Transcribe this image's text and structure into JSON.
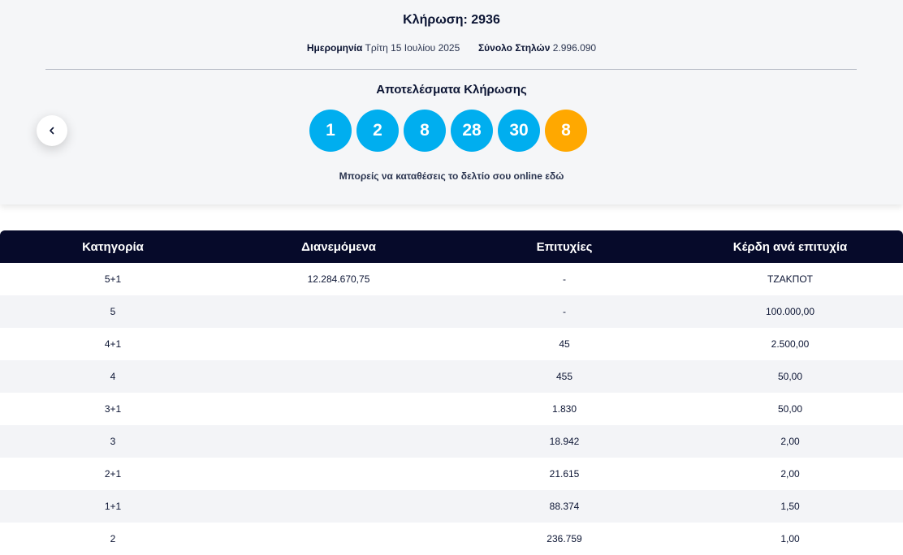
{
  "draw": {
    "title": "Κλήρωση: 2936",
    "date_label": "Ημερομηνία",
    "date_value": "Τρίτη 15 Ιουλίου 2025",
    "columns_label": "Σύνολο Στηλών",
    "columns_value": "2.996.090"
  },
  "results": {
    "title": "Αποτελέσματα Κλήρωσης",
    "balls": [
      {
        "number": "1",
        "color": "#00aeef"
      },
      {
        "number": "2",
        "color": "#00aeef"
      },
      {
        "number": "8",
        "color": "#00aeef"
      },
      {
        "number": "28",
        "color": "#00aeef"
      },
      {
        "number": "30",
        "color": "#00aeef"
      },
      {
        "number": "8",
        "color": "#ffa800"
      }
    ],
    "online_text": "Μπορείς να καταθέσεις το δελτίο σου online εδώ"
  },
  "navigation": {
    "prev_icon": "chevron-left-icon"
  },
  "table": {
    "headers": [
      "Κατηγορία",
      "Διανεμόμενα",
      "Επιτυχίες",
      "Κέρδη ανά επιτυχία"
    ],
    "rows": [
      [
        "5+1",
        "12.284.670,75",
        "-",
        "ΤΖΑΚΠΟΤ"
      ],
      [
        "5",
        "",
        "-",
        "100.000,00"
      ],
      [
        "4+1",
        "",
        "45",
        "2.500,00"
      ],
      [
        "4",
        "",
        "455",
        "50,00"
      ],
      [
        "3+1",
        "",
        "1.830",
        "50,00"
      ],
      [
        "3",
        "",
        "18.942",
        "2,00"
      ],
      [
        "2+1",
        "",
        "21.615",
        "2,00"
      ],
      [
        "1+1",
        "",
        "88.374",
        "1,50"
      ],
      [
        "2",
        "",
        "236.759",
        "1,00"
      ]
    ]
  },
  "colors": {
    "header_bg": "#060a2a",
    "main_ball": "#00aeef",
    "bonus_ball": "#ffa800"
  }
}
